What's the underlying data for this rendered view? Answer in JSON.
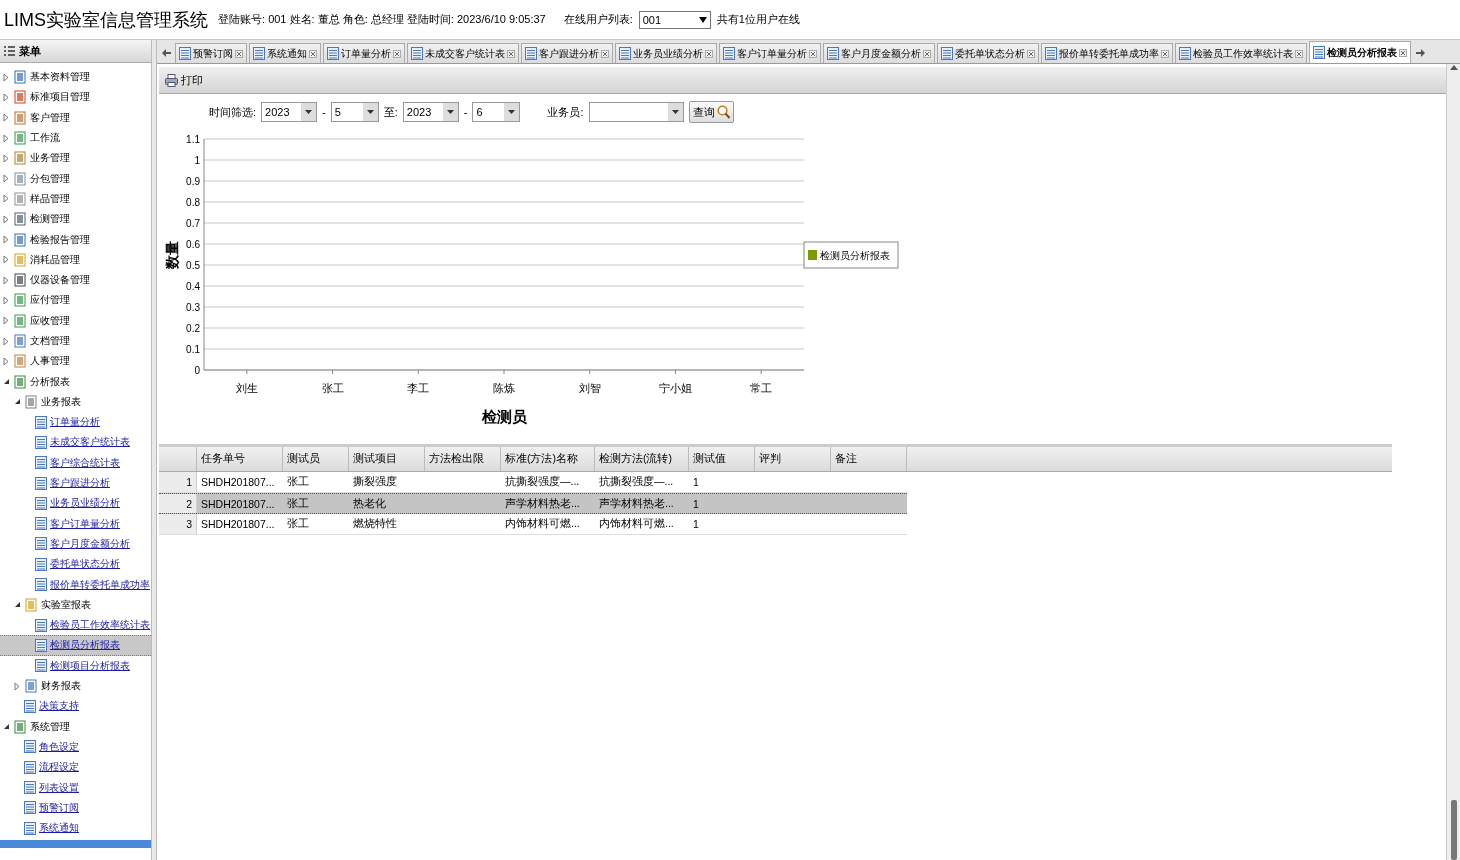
{
  "header": {
    "title": "LIMS实验室信息管理系统",
    "account_info": "登陆账号: 001 姓名: 董总 角色: 总经理 登陆时间: 2023/6/10 9:05:37",
    "online_label": "在线用户列表:",
    "online_user": "001",
    "online_count": "共有1位用户在线"
  },
  "sidebar": {
    "title": "菜单",
    "items": [
      {
        "label": "基本资料管理",
        "expanded": false,
        "selected": false
      },
      {
        "label": "标准项目管理",
        "expanded": false,
        "selected": false
      },
      {
        "label": "客户管理",
        "expanded": false,
        "selected": false
      },
      {
        "label": "工作流",
        "expanded": false,
        "selected": false
      },
      {
        "label": "业务管理",
        "expanded": false,
        "selected": false
      },
      {
        "label": "分包管理",
        "expanded": false,
        "selected": false
      },
      {
        "label": "样品管理",
        "expanded": false,
        "selected": false
      },
      {
        "label": "检测管理",
        "expanded": false,
        "selected": false
      },
      {
        "label": "检验报告管理",
        "expanded": false,
        "selected": false
      },
      {
        "label": "消耗品管理",
        "expanded": false,
        "selected": false
      },
      {
        "label": "仪器设备管理",
        "expanded": false,
        "selected": false
      },
      {
        "label": "应付管理",
        "expanded": false,
        "selected": false
      },
      {
        "label": "应收管理",
        "expanded": false,
        "selected": false
      },
      {
        "label": "文档管理",
        "expanded": false,
        "selected": false
      },
      {
        "label": "人事管理",
        "expanded": false,
        "selected": false
      },
      {
        "label": "分析报表",
        "expanded": true,
        "selected": false,
        "children": [
          {
            "label": "业务报表",
            "expanded": true,
            "selected": false,
            "children": [
              {
                "label": "订单量分析",
                "selected": false
              },
              {
                "label": "未成交客户统计表",
                "selected": false
              },
              {
                "label": "客户综合统计表",
                "selected": false
              },
              {
                "label": "客户跟进分析",
                "selected": false
              },
              {
                "label": "业务员业绩分析",
                "selected": false
              },
              {
                "label": "客户订单量分析",
                "selected": false
              },
              {
                "label": "客户月度金额分析",
                "selected": false
              },
              {
                "label": "委托单状态分析",
                "selected": false
              },
              {
                "label": "报价单转委托单成功率",
                "selected": false
              }
            ]
          },
          {
            "label": "实验室报表",
            "expanded": true,
            "selected": false,
            "children": [
              {
                "label": "检验员工作效率统计表",
                "selected": false
              },
              {
                "label": "检测员分析报表",
                "selected": true
              },
              {
                "label": "检测项目分析报表",
                "selected": false
              }
            ]
          },
          {
            "label": "财务报表",
            "expanded": false,
            "selected": false
          },
          {
            "label": "决策支持",
            "selected": false
          }
        ]
      },
      {
        "label": "系统管理",
        "expanded": true,
        "selected": false,
        "children": [
          {
            "label": "角色设定",
            "selected": false
          },
          {
            "label": "流程设定",
            "selected": false
          },
          {
            "label": "列表设置",
            "selected": false
          },
          {
            "label": "预警订阅",
            "selected": false
          },
          {
            "label": "系统通知",
            "selected": false
          }
        ]
      }
    ]
  },
  "tabs": [
    {
      "label": "预警订阅",
      "selected": false
    },
    {
      "label": "系统通知",
      "selected": false
    },
    {
      "label": "订单量分析",
      "selected": false
    },
    {
      "label": "未成交客户统计表",
      "selected": false
    },
    {
      "label": "客户跟进分析",
      "selected": false
    },
    {
      "label": "业务员业绩分析",
      "selected": false
    },
    {
      "label": "客户订单量分析",
      "selected": false
    },
    {
      "label": "客户月度金额分析",
      "selected": false
    },
    {
      "label": "委托单状态分析",
      "selected": false
    },
    {
      "label": "报价单转委托单成功率",
      "selected": false
    },
    {
      "label": "检验员工作效率统计表",
      "selected": false
    },
    {
      "label": "检测员分析报表",
      "selected": true
    }
  ],
  "toolbar": {
    "print": "打印"
  },
  "filter": {
    "time_label": "时间筛选:",
    "from_year": "2023",
    "separator_1": "-",
    "from_month": "5",
    "to_label": "至:",
    "to_year": "2023",
    "separator_2": "-",
    "to_month": "6",
    "staff_label": "业务员:",
    "query_button": "查询"
  },
  "chart_data": {
    "type": "bar",
    "xlabel": "检测员",
    "ylabel": "数量",
    "categories": [
      "刘生",
      "张工",
      "李工",
      "陈炼",
      "刘智",
      "宁小姐",
      "常工"
    ],
    "series": [
      {
        "name": "检测员分析报表",
        "color": "#7a9a01",
        "values": [
          null,
          null,
          null,
          null,
          null,
          null,
          null
        ]
      }
    ],
    "ylim": [
      0,
      1.1
    ],
    "grid": true,
    "yticks": [
      0,
      0.1,
      0.2,
      0.3,
      0.4,
      0.5,
      0.6,
      0.7,
      0.8,
      0.9,
      1,
      1.1
    ]
  },
  "grid": {
    "columns": [
      "任务单号",
      "测试员",
      "测试项目",
      "方法检出限",
      "标准(方法)名称",
      "检测方法(流转)",
      "测试值",
      "评判",
      "备注"
    ],
    "rows": [
      {
        "number": "1",
        "selected": false,
        "cells": [
          "SHDH201807...",
          "张工",
          "撕裂强度",
          null,
          "抗撕裂强度—...",
          "抗撕裂强度—...",
          "1",
          null,
          null
        ]
      },
      {
        "number": "2",
        "selected": true,
        "cells": [
          "SHDH201807...",
          "张工",
          "热老化",
          null,
          "声学材料热老...",
          "声学材料热老...",
          "1",
          null,
          null
        ]
      },
      {
        "number": "3",
        "selected": false,
        "cells": [
          "SHDH201807...",
          "张工",
          "燃烧特性",
          null,
          "内饰材料可燃...",
          "内饰材料可燃...",
          "1",
          null,
          null
        ]
      }
    ]
  }
}
